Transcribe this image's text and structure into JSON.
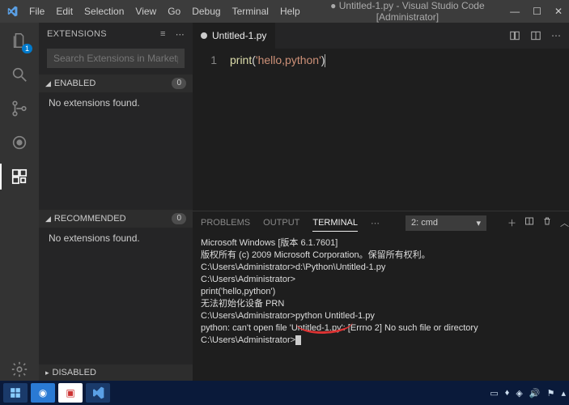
{
  "titlebar": {
    "menu": [
      "File",
      "Edit",
      "Selection",
      "View",
      "Go",
      "Debug",
      "Terminal",
      "Help"
    ],
    "title": "● Untitled-1.py - Visual Studio Code [Administrator]"
  },
  "activitybar": {
    "explorer_badge": "1"
  },
  "sidebar": {
    "title": "EXTENSIONS",
    "search_placeholder": "Search Extensions in Marketplace",
    "sections": {
      "enabled": {
        "label": "ENABLED",
        "count": "0",
        "empty": "No extensions found."
      },
      "recommended": {
        "label": "RECOMMENDED",
        "count": "0",
        "empty": "No extensions found."
      },
      "disabled": {
        "label": "DISABLED"
      }
    }
  },
  "editor": {
    "tab": {
      "label": "Untitled-1.py",
      "dirty": true
    },
    "line_number": "1",
    "code_tokens": {
      "fn": "print",
      "lp": "(",
      "str": "'hello,python'",
      "rp": ")"
    }
  },
  "panel": {
    "tabs": {
      "problems": "PROBLEMS",
      "output": "OUTPUT",
      "terminal": "TERMINAL"
    },
    "selector": "2: cmd",
    "terminal_lines": [
      "Microsoft Windows [版本 6.1.7601]",
      "版权所有 (c) 2009 Microsoft Corporation。保留所有权利。",
      "",
      "C:\\Users\\Administrator>d:\\Python\\Untitled-1.py",
      "",
      "C:\\Users\\Administrator>",
      "print('hello,python')",
      "无法初始化设备 PRN",
      "",
      "C:\\Users\\Administrator>python Untitled-1.py",
      "python: can't open file 'Untitled-1.py': [Errno 2] No such file or directory",
      "",
      "C:\\Users\\Administrator>"
    ]
  }
}
